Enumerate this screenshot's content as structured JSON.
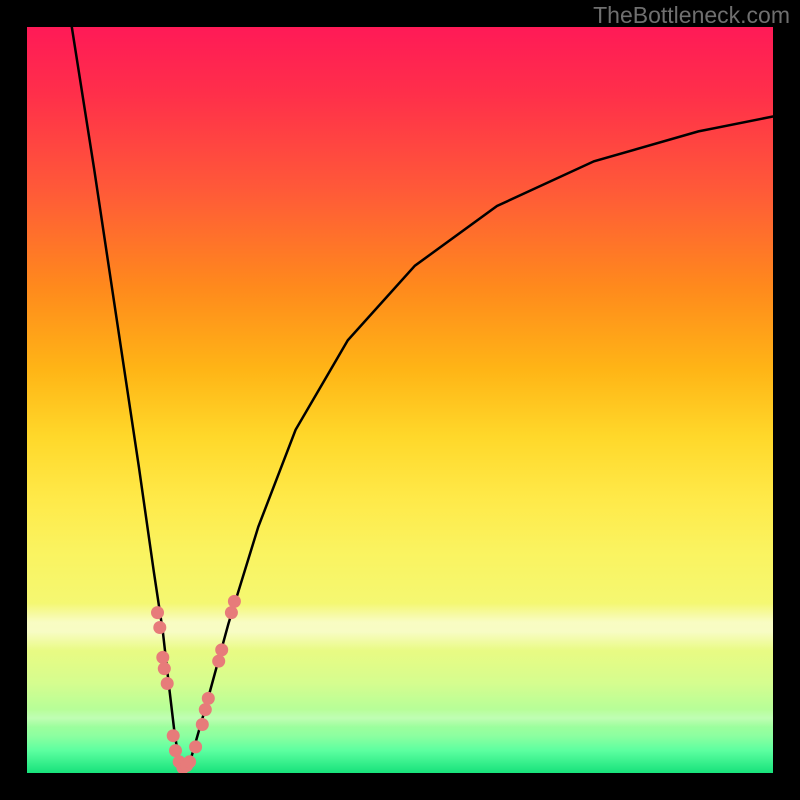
{
  "watermark": "TheBottleneck.com",
  "colors": {
    "frame": "#000000",
    "curve_stroke": "#000000",
    "marker_fill": "#e77b7a",
    "gradient_top": "#ff1a57",
    "gradient_bottom": "#17e27b"
  },
  "chart_data": {
    "type": "line",
    "title": "",
    "xlabel": "",
    "ylabel": "",
    "xlim": [
      0,
      100
    ],
    "ylim": [
      0,
      100
    ],
    "curve": {
      "left": [
        {
          "x": 6.0,
          "y": 100.0
        },
        {
          "x": 9.0,
          "y": 81.0
        },
        {
          "x": 12.0,
          "y": 61.0
        },
        {
          "x": 15.0,
          "y": 41.0
        },
        {
          "x": 17.0,
          "y": 27.0
        },
        {
          "x": 18.2,
          "y": 19.0
        },
        {
          "x": 19.0,
          "y": 12.0
        },
        {
          "x": 19.7,
          "y": 6.0
        },
        {
          "x": 20.3,
          "y": 2.0
        },
        {
          "x": 20.9,
          "y": 0.5
        }
      ],
      "right": [
        {
          "x": 20.9,
          "y": 0.5
        },
        {
          "x": 22.0,
          "y": 2.0
        },
        {
          "x": 24.0,
          "y": 9.0
        },
        {
          "x": 27.0,
          "y": 20.0
        },
        {
          "x": 31.0,
          "y": 33.0
        },
        {
          "x": 36.0,
          "y": 46.0
        },
        {
          "x": 43.0,
          "y": 58.0
        },
        {
          "x": 52.0,
          "y": 68.0
        },
        {
          "x": 63.0,
          "y": 76.0
        },
        {
          "x": 76.0,
          "y": 82.0
        },
        {
          "x": 90.0,
          "y": 86.0
        },
        {
          "x": 100.0,
          "y": 88.0
        }
      ]
    },
    "markers": [
      {
        "x": 17.5,
        "y": 21.5
      },
      {
        "x": 17.8,
        "y": 19.5
      },
      {
        "x": 18.2,
        "y": 15.5
      },
      {
        "x": 18.4,
        "y": 14.0
      },
      {
        "x": 18.8,
        "y": 12.0
      },
      {
        "x": 19.6,
        "y": 5.0
      },
      {
        "x": 19.9,
        "y": 3.0
      },
      {
        "x": 20.4,
        "y": 1.5
      },
      {
        "x": 20.9,
        "y": 0.7
      },
      {
        "x": 21.4,
        "y": 1.0
      },
      {
        "x": 21.8,
        "y": 1.5
      },
      {
        "x": 22.6,
        "y": 3.5
      },
      {
        "x": 23.5,
        "y": 6.5
      },
      {
        "x": 23.9,
        "y": 8.5
      },
      {
        "x": 24.3,
        "y": 10.0
      },
      {
        "x": 25.7,
        "y": 15.0
      },
      {
        "x": 26.1,
        "y": 16.5
      },
      {
        "x": 27.4,
        "y": 21.5
      },
      {
        "x": 27.8,
        "y": 23.0
      }
    ]
  }
}
